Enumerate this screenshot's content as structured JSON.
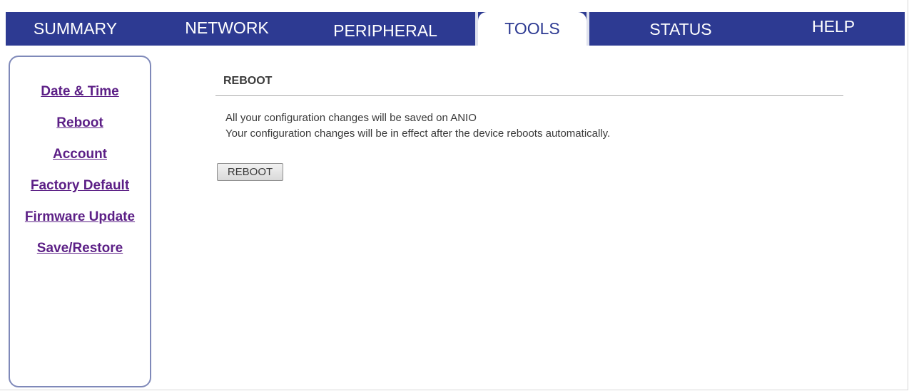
{
  "nav": {
    "tabs": [
      {
        "label": "SUMMARY"
      },
      {
        "label": "NETWORK"
      },
      {
        "label": "PERIPHERAL"
      },
      {
        "label": "TOOLS"
      },
      {
        "label": "STATUS"
      },
      {
        "label": "HELP"
      }
    ],
    "active": "TOOLS"
  },
  "sidebar": {
    "items": [
      {
        "label": "Date & Time"
      },
      {
        "label": "Reboot"
      },
      {
        "label": "Account"
      },
      {
        "label": "Factory Default"
      },
      {
        "label": "Firmware Update"
      },
      {
        "label": "Save/Restore"
      }
    ]
  },
  "main": {
    "title": "REBOOT",
    "message_line1": "All your configuration changes will be saved on ANIO",
    "message_line2": "Your configuration changes will be in effect after the device reboots automatically.",
    "button_label": "REBOOT"
  },
  "colors": {
    "nav_background": "#2d3a92",
    "link": "#5c1f86",
    "sidebar_border": "#7f89b9"
  }
}
